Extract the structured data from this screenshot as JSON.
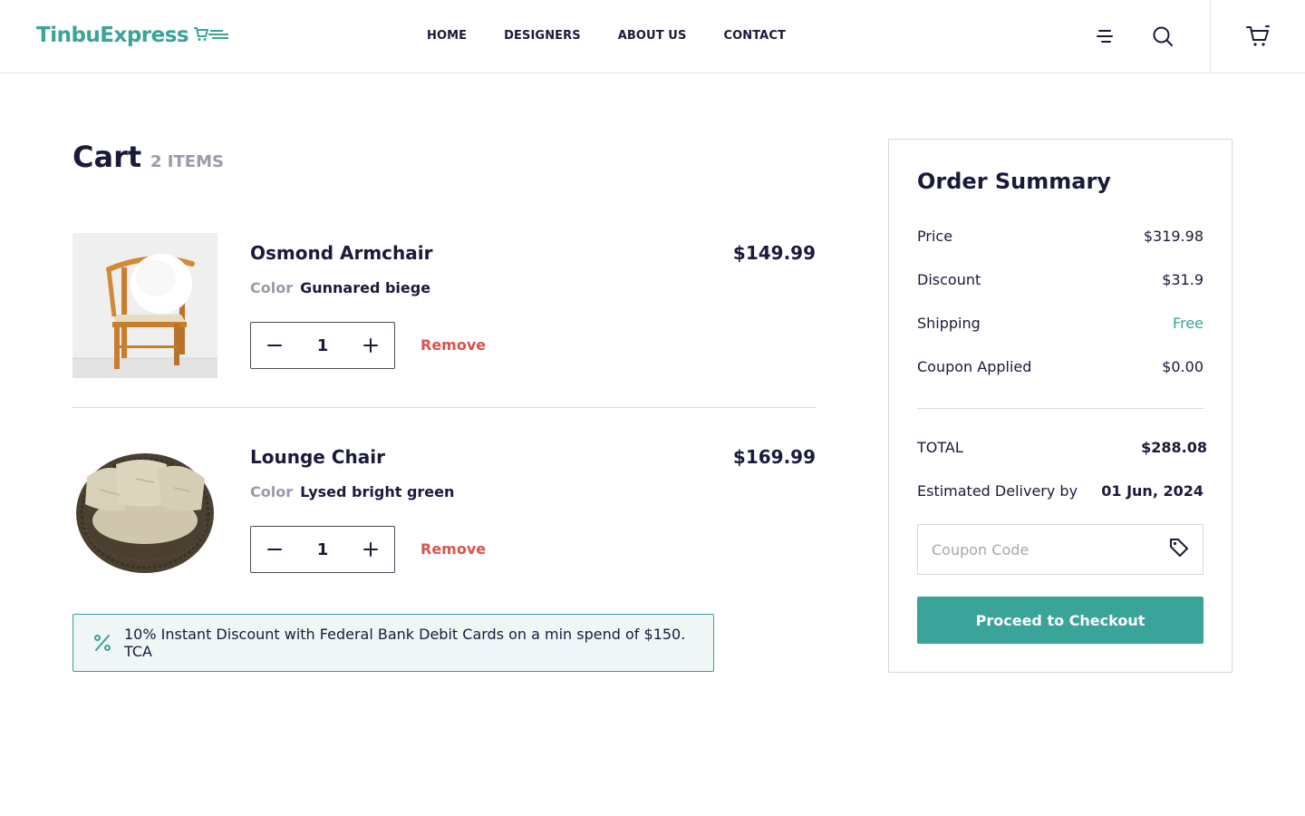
{
  "brand": {
    "name": "TinbuExpress",
    "accent": "#3aa39a"
  },
  "nav": {
    "items": [
      {
        "label": "HOME"
      },
      {
        "label": "DESIGNERS"
      },
      {
        "label": "ABOUT US"
      },
      {
        "label": "CONTACT"
      }
    ]
  },
  "header_icons": [
    "menu-icon",
    "search-icon",
    "cart-icon"
  ],
  "cart": {
    "title": "Cart",
    "count_label": "2 ITEMS",
    "items": [
      {
        "name": "Osmond Armchair",
        "price": "$149.99",
        "color_label": "Color",
        "color_value": "Gunnared biege",
        "quantity": "1",
        "remove_label": "Remove"
      },
      {
        "name": "Lounge Chair",
        "price": "$169.99",
        "color_label": "Color",
        "color_value": "Lysed bright green",
        "quantity": "1",
        "remove_label": "Remove"
      }
    ],
    "banner": "10% Instant Discount with Federal Bank Debit Cards on a min spend of $150. TCA"
  },
  "summary": {
    "title": "Order Summary",
    "price_label": "Price",
    "price_value": "$319.98",
    "discount_label": "Discount",
    "discount_value": "$31.9",
    "shipping_label": "Shipping",
    "shipping_value": "Free",
    "coupon_applied_label": "Coupon Applied",
    "coupon_applied_value": "$0.00",
    "total_label": "TOTAL",
    "total_value": "$288.08",
    "delivery_label": "Estimated Delivery by",
    "delivery_value": "01 Jun, 2024",
    "coupon_placeholder": "Coupon Code",
    "checkout_label": "Proceed to Checkout"
  },
  "colors": {
    "accent": "#3aa39a",
    "text": "#1a1a3a",
    "muted": "#9a9aa8",
    "remove": "#d9534f"
  }
}
